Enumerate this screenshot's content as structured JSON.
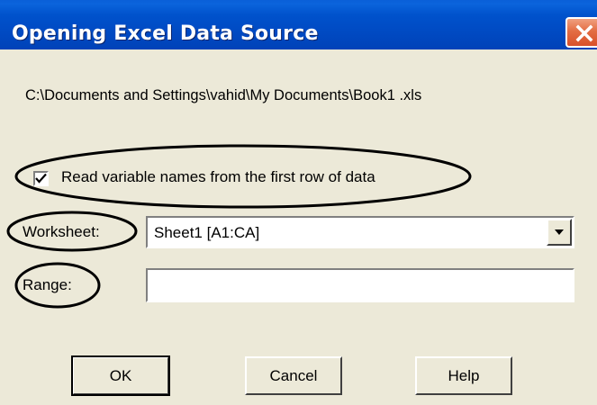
{
  "window": {
    "title": "Opening Excel Data Source",
    "close_icon": "close-icon"
  },
  "dialog": {
    "file_path": "C:\\Documents and Settings\\vahid\\My Documents\\Book1 .xls",
    "read_names_checkbox": {
      "label": "Read variable names from the first row of data",
      "checked": true
    },
    "worksheet": {
      "label": "Worksheet:",
      "selected": "Sheet1  [A1:CA]",
      "dropdown_icon": "chevron-down-icon"
    },
    "range": {
      "label": "Range:",
      "value": ""
    },
    "buttons": {
      "ok": "OK",
      "cancel": "Cancel",
      "help": "Help"
    }
  },
  "colors": {
    "titlebar": "#0054e3",
    "client_background": "#ece9d8",
    "close_button": "#e36d43",
    "annotation": "#000000"
  }
}
